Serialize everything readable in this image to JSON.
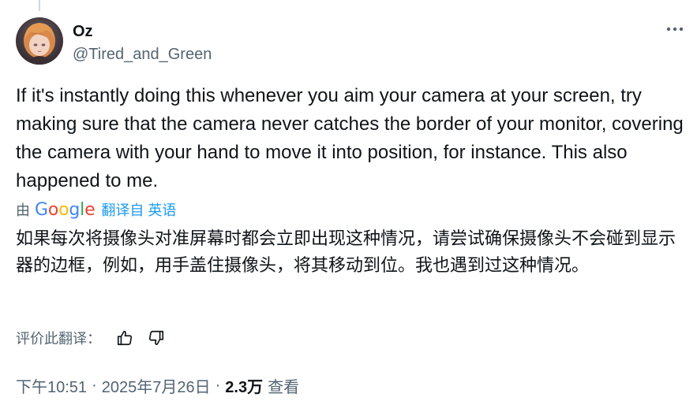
{
  "user": {
    "display_name": "Oz",
    "handle": "@Tired_and_Green"
  },
  "tweet": {
    "text": "If it's instantly doing this whenever you aim your camera at your screen, try making sure that the camera never catches the border of your monitor, covering the camera with your hand to move it into position, for instance. This also happened to me."
  },
  "translation": {
    "by_prefix": "由",
    "provider": "Google",
    "translated_from": "翻译自 英语",
    "text": "如果每次将摄像头对准屏幕时都会立即出现这种情况，请尝试确保摄像头不会碰到显示器的边框，例如，用手盖住摄像头，将其移动到位。我也遇到过这种情况。",
    "rate_label": "评价此翻译："
  },
  "meta": {
    "time": "下午10:51",
    "separator": "·",
    "date": "2025年7月26日",
    "views_count": "2.3万",
    "views_label": "查看"
  },
  "colors": {
    "text_primary": "#0f1419",
    "text_secondary": "#536471",
    "link_blue": "#1d9bf0",
    "google_blue": "#4285F4",
    "google_red": "#EA4335",
    "google_yellow": "#FBBC05",
    "google_green": "#34A853"
  },
  "icons": {
    "more": "more-horizontal-icon",
    "thumbs_up": "thumbs-up-icon",
    "thumbs_down": "thumbs-down-icon"
  }
}
